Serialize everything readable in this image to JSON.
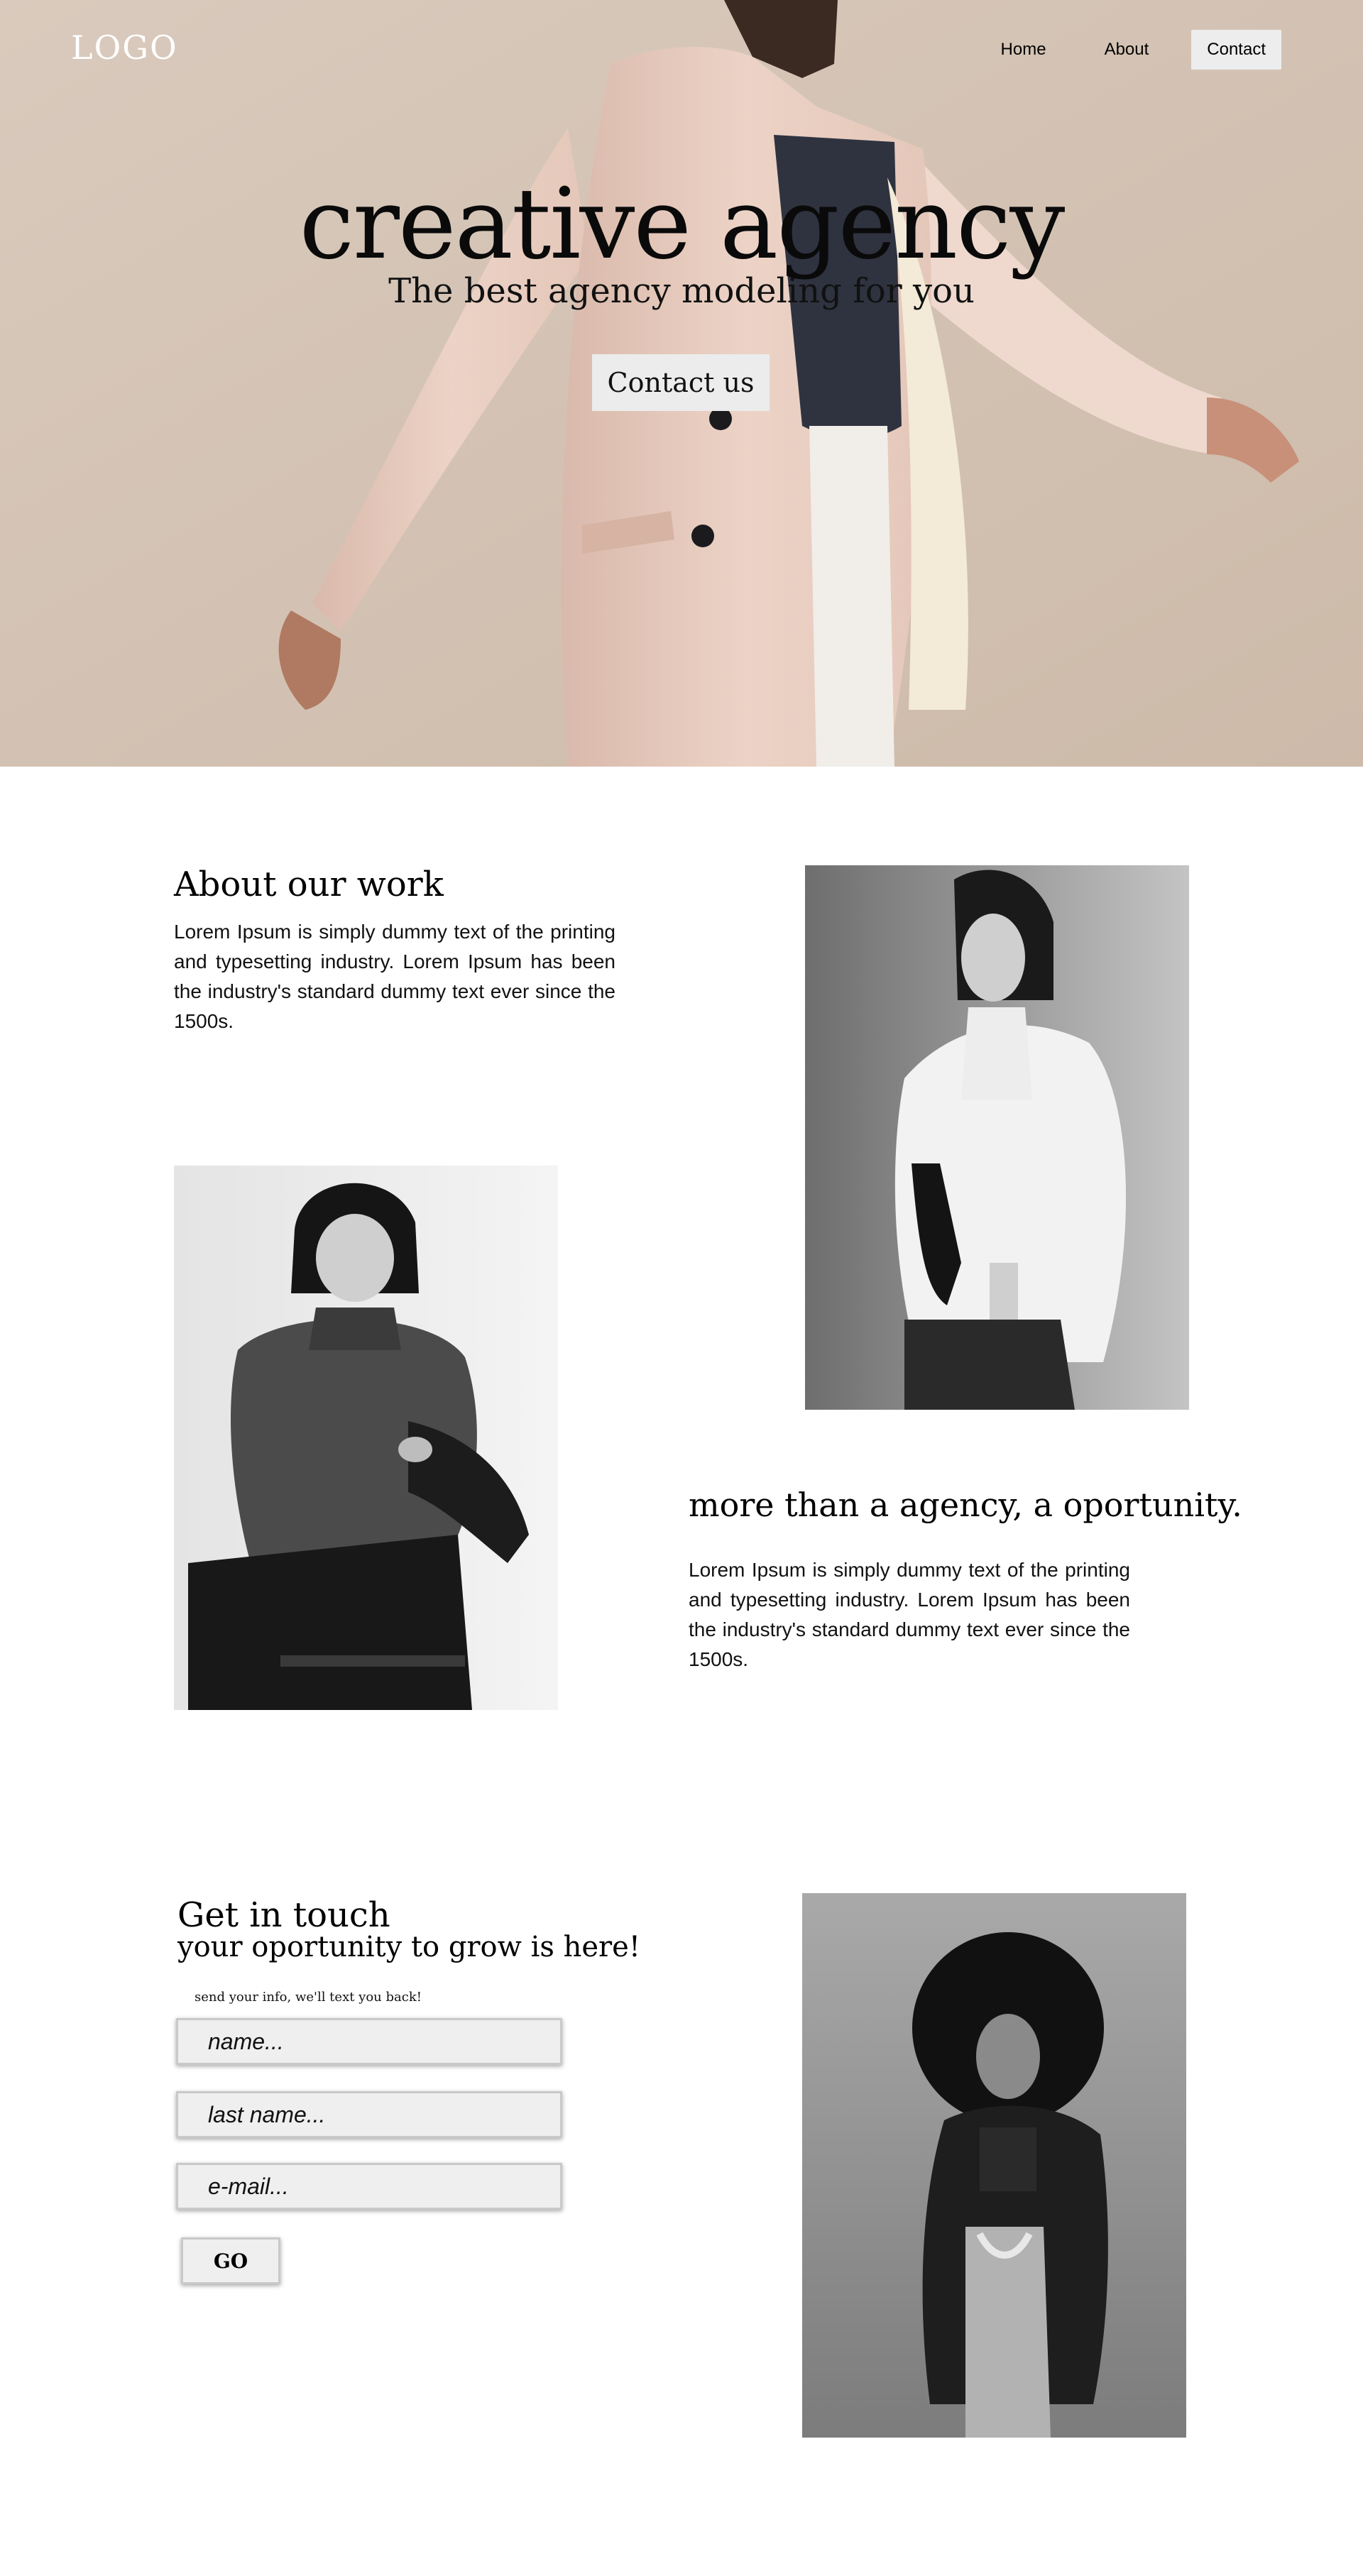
{
  "header": {
    "logo": "LOGO",
    "nav": [
      {
        "label": "Home"
      },
      {
        "label": "About"
      },
      {
        "label": "Contact"
      }
    ]
  },
  "hero": {
    "title": "creative agency",
    "subtitle": "The best agency modeling for you",
    "cta_label": "Contact us"
  },
  "about": {
    "title": "About our work",
    "text": "Lorem Ipsum is simply dummy text of the printing and typesetting industry. Lorem Ipsum has been the industry's standard dummy text ever since the 1500s."
  },
  "more": {
    "title": "more than a agency, a oportunity.",
    "text": "Lorem Ipsum is simply dummy text of the printing and typesetting industry. Lorem Ipsum has been the industry's standard dummy text ever since the 1500s."
  },
  "contact": {
    "title": "Get in touch",
    "subtitle": "your oportunity to grow is here!",
    "note": "send your info, we'll text you back!",
    "fields": {
      "name_placeholder": "name...",
      "last_name_placeholder": "last name...",
      "email_placeholder": "e-mail..."
    },
    "submit_label": "GO"
  },
  "colors": {
    "hero_background": "#d4c4b5",
    "button_background": "#ececec",
    "page_background": "#ffffff",
    "text": "#000000"
  },
  "icons": {
    "hero_image": "model-in-blazer-photo",
    "photo_1": "model-white-jacket-photo",
    "photo_2": "model-sweater-chair-photo",
    "photo_3": "model-afro-jacket-photo"
  }
}
